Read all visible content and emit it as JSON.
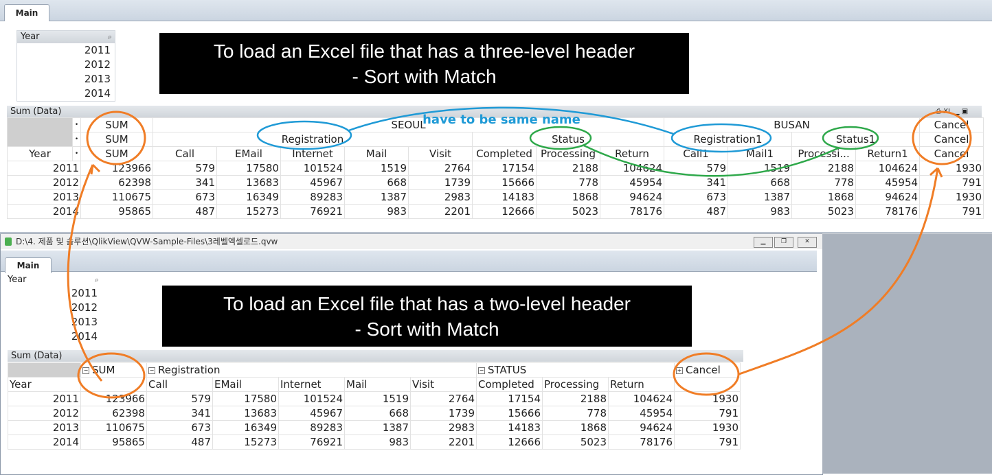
{
  "top": {
    "tab_label": "Main",
    "listbox": {
      "title": "Year",
      "items": [
        "2011",
        "2012",
        "2013",
        "2014"
      ]
    },
    "banner": {
      "line1": "To load an Excel file that has a three-level header",
      "line2": "- Sort with Match"
    },
    "chart_title": "Sum (Data)",
    "header": {
      "sum": [
        "SUM",
        "SUM",
        "SUM"
      ],
      "seoul": "SEOUL",
      "busan": "BUSAN",
      "registration": "Registration",
      "status": "Status",
      "registration1": "Registration1",
      "status1": "Status1",
      "cancel": [
        "Cancel",
        "Cancel",
        "Cancel"
      ],
      "year": "Year",
      "cols": [
        "Call",
        "EMail",
        "Internet",
        "Mail",
        "Visit",
        "Completed",
        "Processing",
        "Return",
        "Call1",
        "Mail1",
        "Processi...",
        "Return1"
      ]
    },
    "rows": [
      [
        "2011",
        "123966",
        "579",
        "17580",
        "101524",
        "1519",
        "2764",
        "17154",
        "2188",
        "104624",
        "579",
        "1519",
        "2188",
        "104624",
        "1930"
      ],
      [
        "2012",
        "62398",
        "341",
        "13683",
        "45967",
        "668",
        "1739",
        "15666",
        "778",
        "45954",
        "341",
        "668",
        "778",
        "45954",
        "791"
      ],
      [
        "2013",
        "110675",
        "673",
        "16349",
        "89283",
        "1387",
        "2983",
        "14183",
        "1868",
        "94624",
        "673",
        "1387",
        "1868",
        "94624",
        "1930"
      ],
      [
        "2014",
        "95865",
        "487",
        "15273",
        "76921",
        "983",
        "2201",
        "12666",
        "5023",
        "78176",
        "487",
        "983",
        "5023",
        "78176",
        "791"
      ]
    ],
    "annotation": "have to be same name",
    "toolbar_xl": "XL"
  },
  "bottom": {
    "window_title": "D:\\4. 제품 및 솔루션\\QlikView\\QVW-Sample-Files\\3레벨엑셀로드.qvw",
    "tab_label": "Main",
    "listbox": {
      "title": "Year",
      "items": [
        "2011",
        "2012",
        "2013",
        "2014"
      ]
    },
    "banner": {
      "line1": "To load an Excel file that has a two-level header",
      "line2": "- Sort with Match"
    },
    "chart_title": "Sum (Data)",
    "header": {
      "sum": "SUM",
      "registration": "Registration",
      "status": "STATUS",
      "cancel": "Cancel",
      "year": "Year",
      "cols": [
        "Call",
        "EMail",
        "Internet",
        "Mail",
        "Visit",
        "Completed",
        "Processing",
        "Return"
      ]
    },
    "rows": [
      [
        "2011",
        "123966",
        "579",
        "17580",
        "101524",
        "1519",
        "2764",
        "17154",
        "2188",
        "104624",
        "1930"
      ],
      [
        "2012",
        "62398",
        "341",
        "13683",
        "45967",
        "668",
        "1739",
        "15666",
        "778",
        "45954",
        "791"
      ],
      [
        "2013",
        "110675",
        "673",
        "16349",
        "89283",
        "1387",
        "2983",
        "14183",
        "1868",
        "94624",
        "1930"
      ],
      [
        "2014",
        "95865",
        "487",
        "15273",
        "76921",
        "983",
        "2201",
        "12666",
        "5023",
        "78176",
        "791"
      ]
    ]
  },
  "colors": {
    "orange": "#f07d26",
    "blue": "#1f9ad6",
    "green": "#2ea84a",
    "banner_bg": "#000000"
  }
}
